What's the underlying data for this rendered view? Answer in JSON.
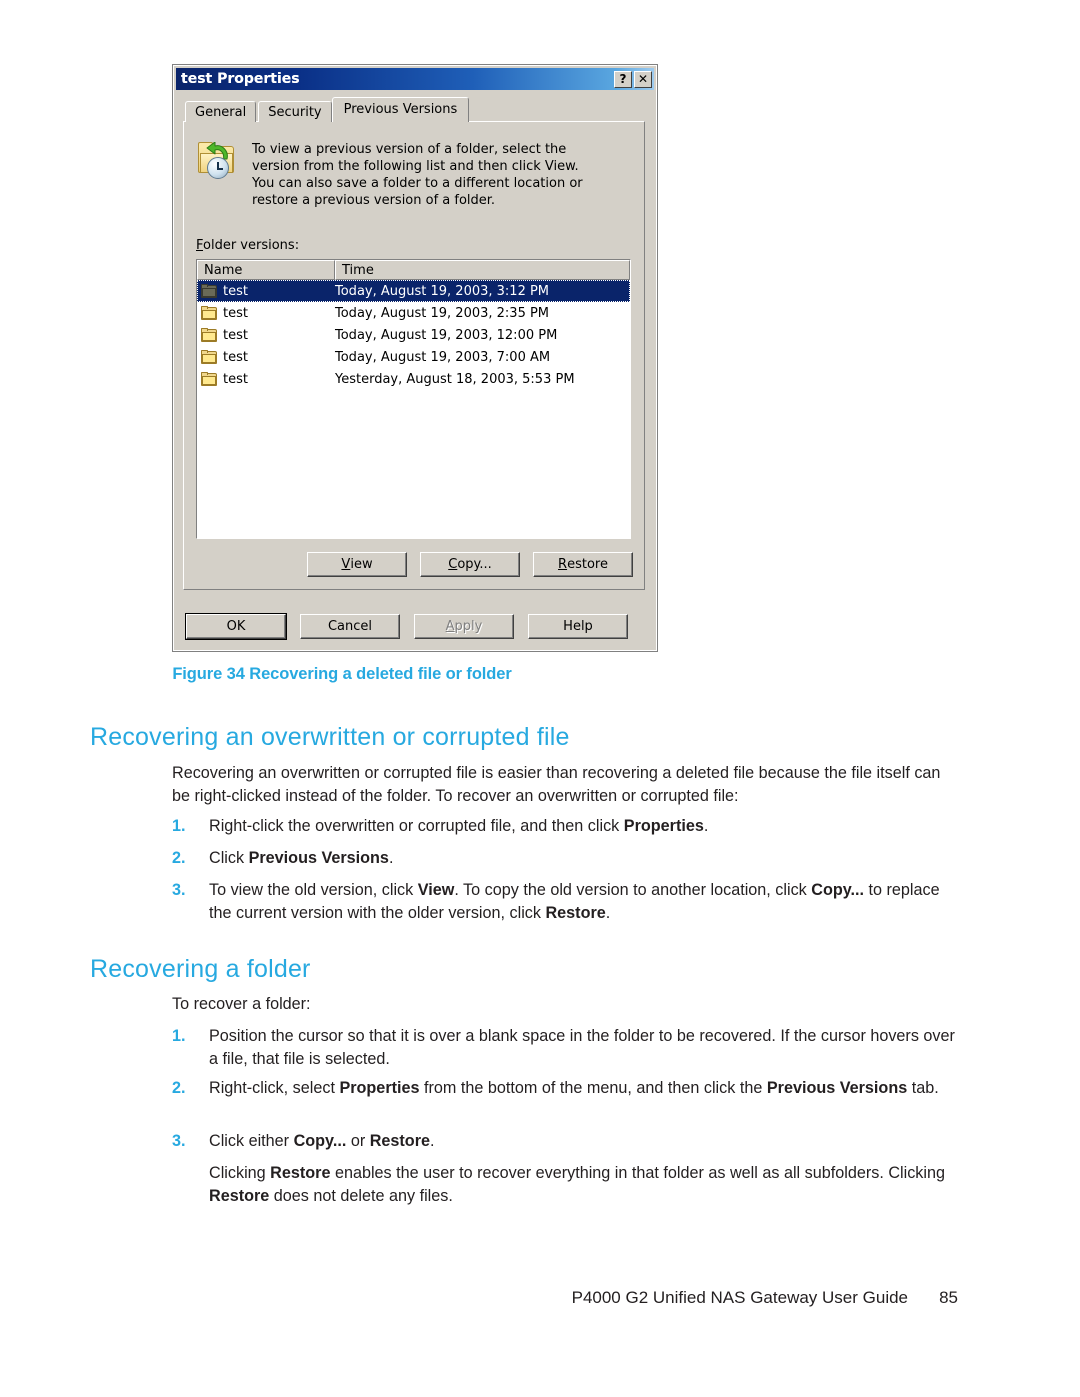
{
  "page": {
    "number": "85",
    "guide_title": "P4000 G2 Unified NAS Gateway User Guide",
    "accent_color": "#27a9e0"
  },
  "figure": {
    "caption": "Figure 34 Recovering a deleted file or folder"
  },
  "dialog": {
    "title": "test Properties",
    "help_button": "?",
    "close_button": "✕",
    "tabs": [
      {
        "label": "General",
        "active": false
      },
      {
        "label": "Security",
        "active": false
      },
      {
        "label": "Previous Versions",
        "active": true
      }
    ],
    "info_text_line1": "To view a previous version of a folder, select the",
    "info_text_line2_a": "version from the following list and then click View.",
    "info_text_line3": "You can also save a folder to a different location or",
    "info_text_line4": "restore a previous version of a folder.",
    "folder_versions_label_a": "F",
    "folder_versions_label_b": "older versions:",
    "columns": [
      "Name",
      "Time"
    ],
    "rows": [
      {
        "name": "test",
        "time": "Today, August 19, 2003, 3:12 PM",
        "selected": true
      },
      {
        "name": "test",
        "time": "Today, August 19, 2003, 2:35 PM",
        "selected": false
      },
      {
        "name": "test",
        "time": "Today, August 19, 2003, 12:00 PM",
        "selected": false
      },
      {
        "name": "test",
        "time": "Today, August 19, 2003, 7:00 AM",
        "selected": false
      },
      {
        "name": "test",
        "time": "Yesterday, August 18, 2003, 5:53 PM",
        "selected": false
      }
    ],
    "action_buttons": [
      {
        "label": "View",
        "mnemonic": "V",
        "rest": "iew",
        "disabled": false
      },
      {
        "label": "Copy...",
        "mnemonic": "C",
        "rest": "opy...",
        "disabled": false
      },
      {
        "label": "Restore",
        "mnemonic": "R",
        "rest": "estore",
        "disabled": false
      }
    ],
    "footer_buttons": [
      {
        "label": "OK",
        "disabled": false,
        "default": true
      },
      {
        "label": "Cancel",
        "disabled": false,
        "default": false
      },
      {
        "label": "Apply",
        "mnemonic": "A",
        "rest": "pply",
        "disabled": true,
        "default": false
      },
      {
        "label": "Help",
        "disabled": false,
        "default": false
      }
    ]
  },
  "sections": [
    {
      "heading": "Recovering an overwritten or corrupted file",
      "intro": "Recovering an overwritten or corrupted file is easier than recovering a deleted file because the file itself can be right-clicked instead of the folder. To recover an overwritten or corrupted file:",
      "steps": [
        {
          "num": "1.",
          "html": "Right-click the overwritten or corrupted file, and then click <b>Properties</b>."
        },
        {
          "num": "2.",
          "html": "Click <b>Previous Versions</b>."
        },
        {
          "num": "3.",
          "html": "To view the old version, click <b>View</b>. To copy the old version to another location, click <b>Copy...</b> to replace the current version with the older version, click <b>Restore</b>."
        }
      ]
    },
    {
      "heading": "Recovering a folder",
      "intro": "To recover a folder:",
      "steps": [
        {
          "num": "1.",
          "html": "Position the cursor so that it is over a blank space in the folder to be recovered. If the cursor hovers over a file, that file is selected."
        },
        {
          "num": "2.",
          "html": "Right-click, select <b>Properties</b> from the bottom of the menu, and then click the <b>Previous Versions</b> tab."
        },
        {
          "num": "3.",
          "html": "Click either <b>Copy...</b> or <b>Restore</b>."
        }
      ],
      "note": "Clicking <b>Restore</b> enables the user to recover everything in that folder as well as all subfolders. Clicking <b>Restore</b> does not delete any files."
    }
  ]
}
